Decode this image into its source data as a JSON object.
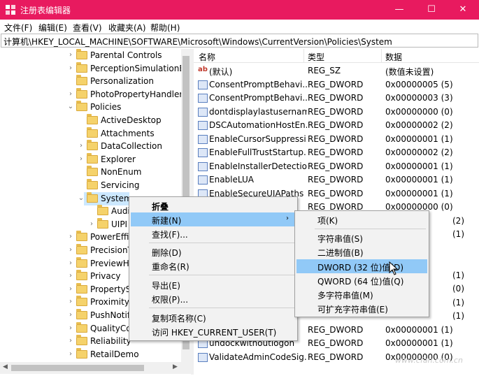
{
  "window": {
    "title": "注册表编辑器",
    "minimize": "—",
    "maximize": "☐",
    "close": "✕",
    "accent": "#e81a5f"
  },
  "menubar": {
    "file": "文件(F)",
    "edit": "编辑(E)",
    "view": "查看(V)",
    "favorites": "收藏夹(A)",
    "help": "帮助(H)"
  },
  "address": {
    "path": "计算机\\HKEY_LOCAL_MACHINE\\SOFTWARE\\Microsoft\\Windows\\CurrentVersion\\Policies\\System"
  },
  "tree": {
    "items": [
      {
        "label": "Parental Controls",
        "expander": "›"
      },
      {
        "label": "PerceptionSimulationExt",
        "expander": "›"
      },
      {
        "label": "Personalization",
        "expander": ""
      },
      {
        "label": "PhotoPropertyHandler",
        "expander": "›"
      },
      {
        "label": "Policies",
        "expander": "⌄"
      },
      {
        "label": "ActiveDesktop",
        "expander": ""
      },
      {
        "label": "Attachments",
        "expander": ""
      },
      {
        "label": "DataCollection",
        "expander": "›"
      },
      {
        "label": "Explorer",
        "expander": "›"
      },
      {
        "label": "NonEnum",
        "expander": ""
      },
      {
        "label": "Servicing",
        "expander": ""
      },
      {
        "label": "System",
        "expander": "⌄"
      },
      {
        "label": "Audi",
        "expander": ""
      },
      {
        "label": "UIPI",
        "expander": "›"
      },
      {
        "label": "PowerEffic",
        "expander": "›"
      },
      {
        "label": "PrecisionT",
        "expander": "›"
      },
      {
        "label": "PreviewHa",
        "expander": "›"
      },
      {
        "label": "Privacy",
        "expander": "›"
      },
      {
        "label": "PropertyS",
        "expander": "›"
      },
      {
        "label": "Proximity",
        "expander": "›"
      },
      {
        "label": "PushNotifi",
        "expander": "›"
      },
      {
        "label": "QualityCo",
        "expander": "›"
      },
      {
        "label": "Reliability",
        "expander": "›"
      },
      {
        "label": "RetailDemo",
        "expander": "›"
      }
    ]
  },
  "list": {
    "headers": {
      "name": "名称",
      "type": "类型",
      "data": "数据"
    },
    "rows": [
      {
        "name": "(默认)",
        "type": "REG_SZ",
        "data": "(数值未设置)",
        "icon": "ab"
      },
      {
        "name": "ConsentPromptBehavi...",
        "type": "REG_DWORD",
        "data": "0x00000005 (5)",
        "icon": "dword"
      },
      {
        "name": "ConsentPromptBehavi...",
        "type": "REG_DWORD",
        "data": "0x00000003 (3)",
        "icon": "dword"
      },
      {
        "name": "dontdisplaylastusername",
        "type": "REG_DWORD",
        "data": "0x00000000 (0)",
        "icon": "dword"
      },
      {
        "name": "DSCAutomationHostEn...",
        "type": "REG_DWORD",
        "data": "0x00000002 (2)",
        "icon": "dword"
      },
      {
        "name": "EnableCursorSuppressi...",
        "type": "REG_DWORD",
        "data": "0x00000001 (1)",
        "icon": "dword"
      },
      {
        "name": "EnableFullTrustStartup...",
        "type": "REG_DWORD",
        "data": "0x00000002 (2)",
        "icon": "dword"
      },
      {
        "name": "EnableInstallerDetection",
        "type": "REG_DWORD",
        "data": "0x00000001 (1)",
        "icon": "dword"
      },
      {
        "name": "EnableLUA",
        "type": "REG_DWORD",
        "data": "0x00000001 (1)",
        "icon": "dword"
      },
      {
        "name": "EnableSecureUIAPaths",
        "type": "REG_DWORD",
        "data": "0x00000001 (1)",
        "icon": "dword"
      },
      {
        "name": "",
        "type": "REG_DWORD",
        "data": "0x00000000 (0)",
        "icon": ""
      },
      {
        "name": "",
        "type": "",
        "data": "(2)",
        "icon": ""
      },
      {
        "name": "",
        "type": "",
        "data": "(1)",
        "icon": ""
      },
      {
        "name": "",
        "type": "",
        "data": "",
        "icon": ""
      },
      {
        "name": "",
        "type": "",
        "data": "",
        "icon": ""
      },
      {
        "name": "",
        "type": "",
        "data": "(1)",
        "icon": ""
      },
      {
        "name": "",
        "type": "",
        "data": "(0)",
        "icon": ""
      },
      {
        "name": "",
        "type": "",
        "data": "(1)",
        "icon": ""
      },
      {
        "name": "",
        "type": "",
        "data": "(1)",
        "icon": ""
      },
      {
        "name": "",
        "type": "REG_DWORD",
        "data": "0x00000001 (1)",
        "icon": ""
      },
      {
        "name": "undockwithoutlogon",
        "type": "REG_DWORD",
        "data": "0x00000001 (1)",
        "icon": "dword"
      },
      {
        "name": "ValidateAdminCodeSig...",
        "type": "REG_DWORD",
        "data": "0x00000000 (0)",
        "icon": "dword"
      }
    ]
  },
  "context_menu": {
    "collapse": "折叠",
    "new": "新建(N)",
    "find": "查找(F)...",
    "delete": "删除(D)",
    "rename": "重命名(R)",
    "export": "导出(E)",
    "permissions": "权限(P)...",
    "copy_key_name": "复制项名称(C)",
    "goto_hkcu": "访问 HKEY_CURRENT_USER(T)",
    "submenu_arrow": "›"
  },
  "submenu": {
    "key": "项(K)",
    "string": "字符串值(S)",
    "binary": "二进制值(B)",
    "dword": "DWORD (32 位)值(D)",
    "qword": "QWORD (64 位)值(Q)",
    "multi_string": "多字符串值(M)",
    "expandable_string": "可扩充字符串值(E)"
  },
  "watermark": "www.cfan.com.cn"
}
